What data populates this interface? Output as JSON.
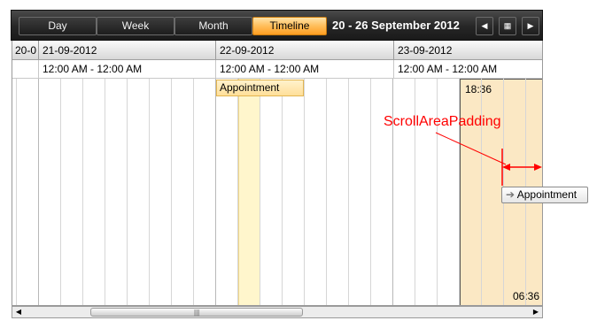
{
  "toolbar": {
    "views": [
      {
        "label": "Day"
      },
      {
        "label": "Week"
      },
      {
        "label": "Month"
      },
      {
        "label": "Timeline",
        "active": true
      }
    ],
    "date_range": "20  - 26 September 2012",
    "nav": {
      "prev": "◀",
      "today": "▦",
      "next": "▶"
    }
  },
  "timeline": {
    "dates": [
      "20-0",
      "21-09-2012",
      "22-09-2012",
      "23-09-2012"
    ],
    "time_ranges": [
      "12:00 AM  -  12:00 AM",
      "12:00 AM  -  12:00 AM",
      "12:00 AM  -  12:00 AM"
    ],
    "appointment": "Appointment",
    "range_start": "18:36",
    "range_end": "06:36"
  },
  "annotation": {
    "label": "ScrollAreaPadding",
    "drag_appointment": "Appointment",
    "drag_icon": "➔",
    "color": "#ff0000"
  },
  "scrollbar": {
    "left_arrow": "◀",
    "right_arrow": "▶",
    "grip": "|||"
  }
}
